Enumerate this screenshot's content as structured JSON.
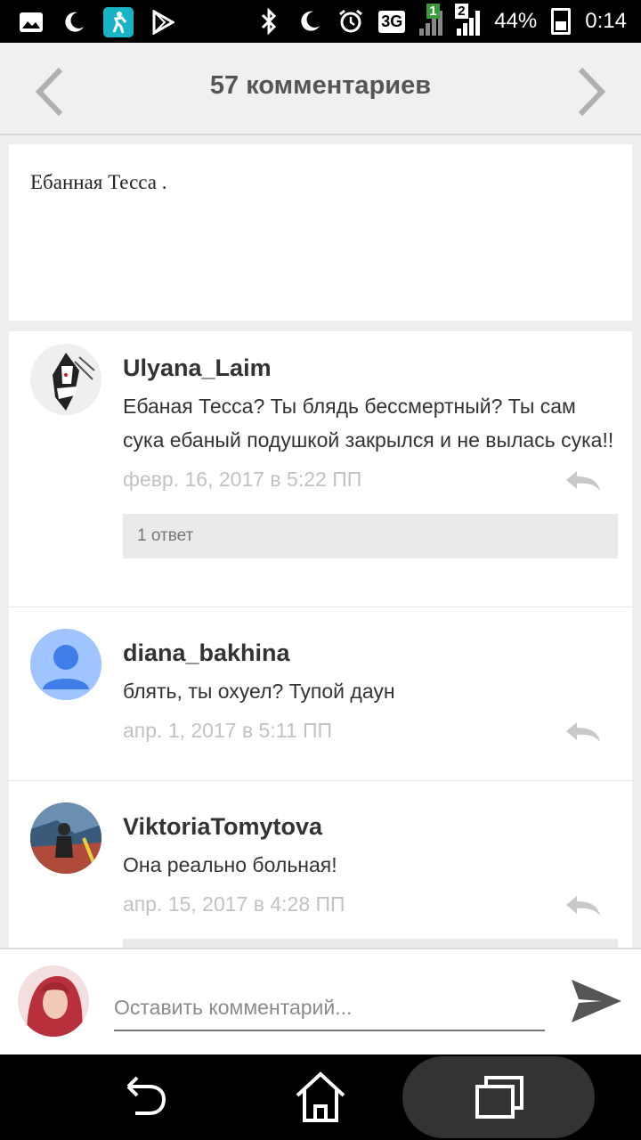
{
  "status_bar": {
    "signal_label": "3G",
    "sim_badge_1": "1",
    "sim_badge_2": "2",
    "battery": "44%",
    "time": "0:14",
    "icons": [
      "gallery-icon",
      "moon-icon",
      "app-icon",
      "play-store-icon",
      "bluetooth-icon",
      "moon-icon",
      "alarm-icon",
      "signal-icon",
      "battery-icon"
    ]
  },
  "header": {
    "title": "57 комментариев",
    "prev_icon": "chevron-left-icon",
    "next_icon": "chevron-right-icon"
  },
  "post": {
    "text": "Ебанная Тесса ."
  },
  "comments": [
    {
      "username": "Ulyana_Laim",
      "text": "Ебаная Тесса? Ты блядь бессмертный? Ты сам сука ебаный подушкой закрылся и не вылась сука!!",
      "date": "февр. 16, 2017 в 5:22 ПП",
      "replies": "1 ответ"
    },
    {
      "username": "diana_bakhina",
      "text": "блять, ты охуел? Тупой даун",
      "date": "апр. 1, 2017 в 5:11 ПП"
    },
    {
      "username": "ViktoriaTomytova",
      "text": "Она реально больная!",
      "date": "апр. 15, 2017 в 4:28 ПП"
    }
  ],
  "composer": {
    "placeholder": "Оставить комментарий..."
  },
  "colors": {
    "header_bg": "#f0f0f0",
    "date_gray": "#c2c2c2",
    "app_icon": "#19b3c6",
    "default_avatar": "#a0c4ff"
  }
}
